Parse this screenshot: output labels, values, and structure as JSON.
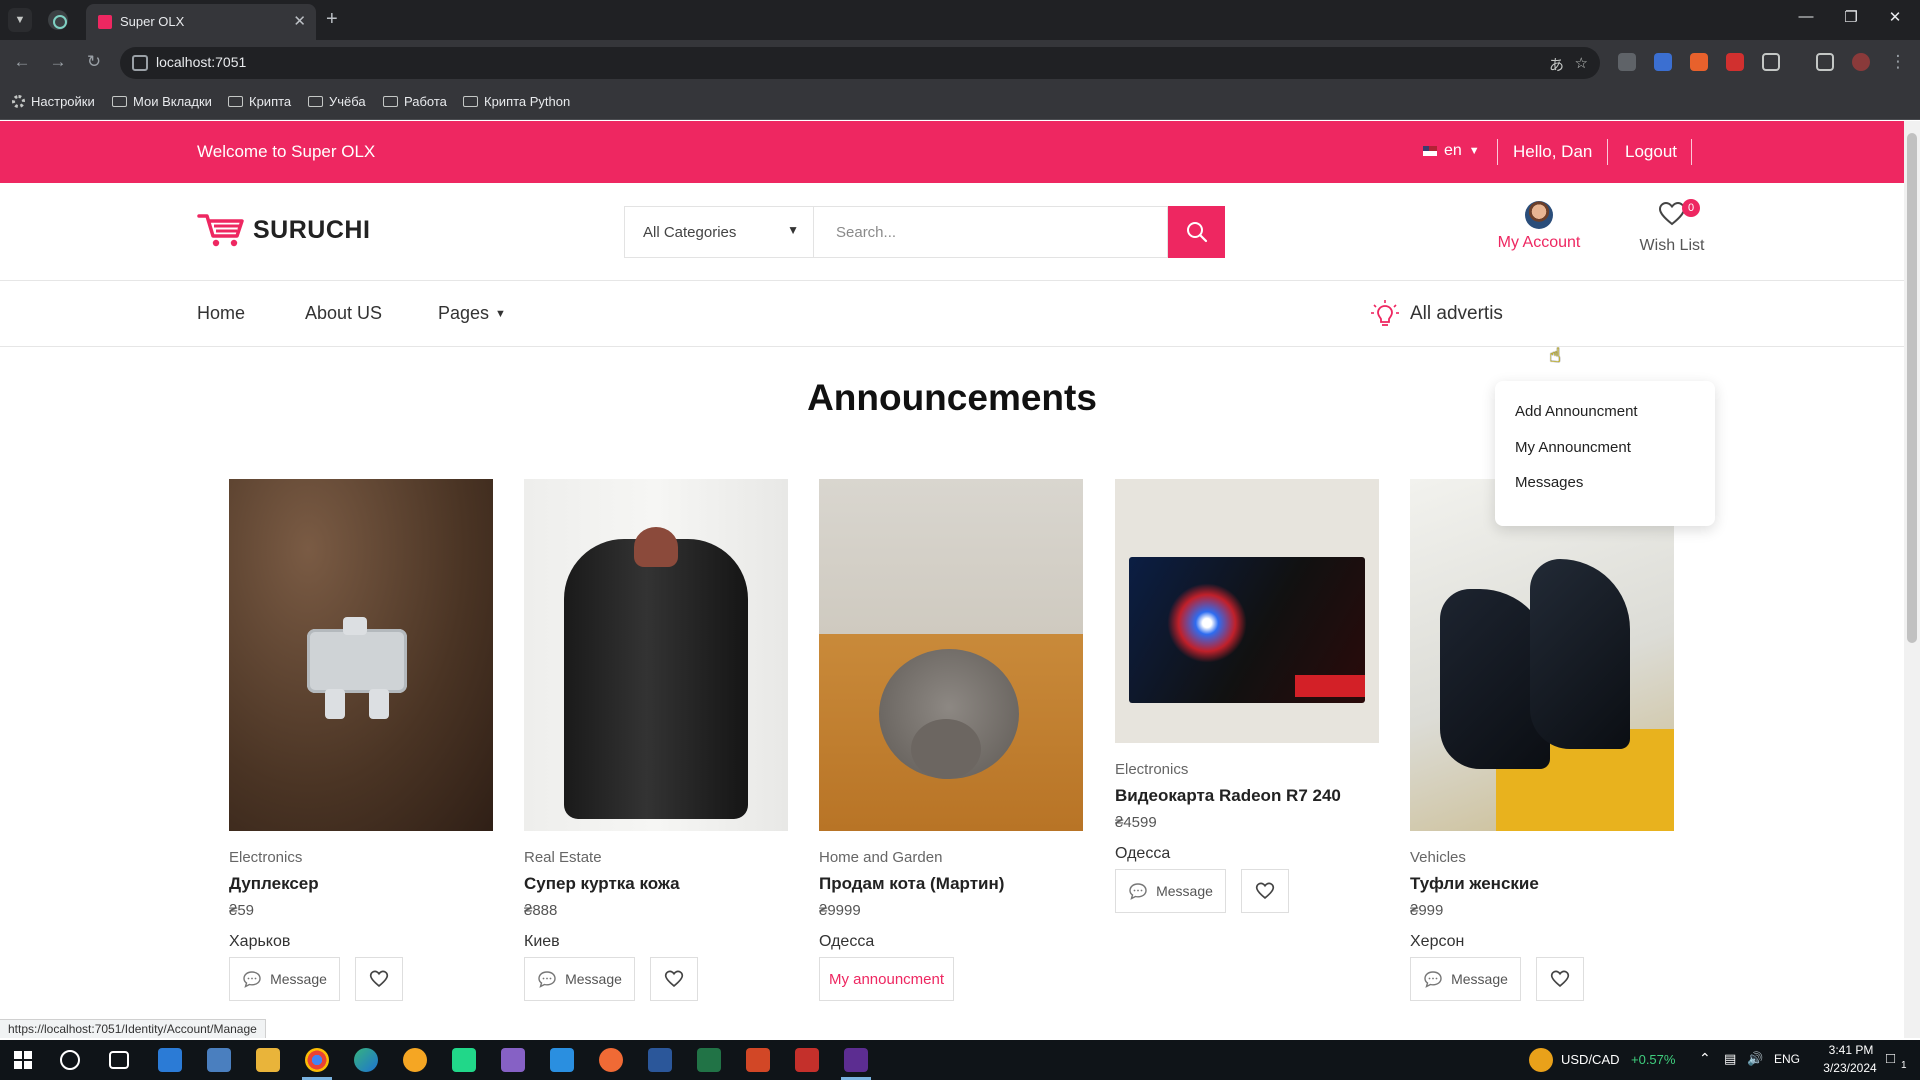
{
  "browser": {
    "tab_title": "Super OLX",
    "url": "localhost:7051",
    "bookmarks": [
      "Настройки",
      "Мои Вкладки",
      "Крипта",
      "Учёба",
      "Работа",
      "Крипта Python"
    ]
  },
  "topbar": {
    "welcome": "Welcome to Super OLX",
    "language": "en",
    "greeting": "Hello, Dan",
    "logout": "Logout"
  },
  "header": {
    "logo_text": "SURUCHI",
    "category_select": "All Categories",
    "search_placeholder": "Search...",
    "my_account": "My Account",
    "wish_list": "Wish List",
    "wish_count": "0"
  },
  "nav": {
    "home": "Home",
    "about": "About US",
    "pages": "Pages",
    "all_ads": "All advertis"
  },
  "account_menu": [
    "Add Announcment",
    "My Announcment",
    "Messages"
  ],
  "page_title": "Announcements",
  "cards": [
    {
      "category": "Electronics",
      "title": "Дуплексер",
      "price": "₴59",
      "city": "Харьков",
      "action": "Message",
      "image": "splitter-photo"
    },
    {
      "category": "Real Estate",
      "title": "Супер куртка кожа",
      "price": "₴888",
      "city": "Киев",
      "action": "Message",
      "image": "leather-jacket-photo"
    },
    {
      "category": "Home and Garden",
      "title": "Продам кота (Мартин)",
      "price": "₴9999",
      "city": "Одесса",
      "action": "My announcment",
      "image": "grey-cat-photo"
    },
    {
      "category": "Electronics",
      "title": "Видеокарта Radeon R7 240",
      "price": "₴4599",
      "city": "Одесса",
      "action": "Message",
      "image": "graphics-card-box-photo"
    },
    {
      "category": "Vehicles",
      "title": "Туфли женские",
      "price": "₴999",
      "city": "Херсон",
      "action": "Message",
      "image": "black-heels-photo"
    }
  ],
  "status_url": "https://localhost:7051/Identity/Account/Manage",
  "taskbar": {
    "ticker": "USD/CAD",
    "ticker_change": "+0.57%",
    "language": "ENG",
    "time": "3:41 PM",
    "date": "3/23/2024",
    "notifications": "1"
  },
  "colors": {
    "accent": "#ee2761",
    "chrome_dark": "#202124",
    "chrome_mid": "#35363a",
    "ticker_green": "#3fcf7e"
  }
}
